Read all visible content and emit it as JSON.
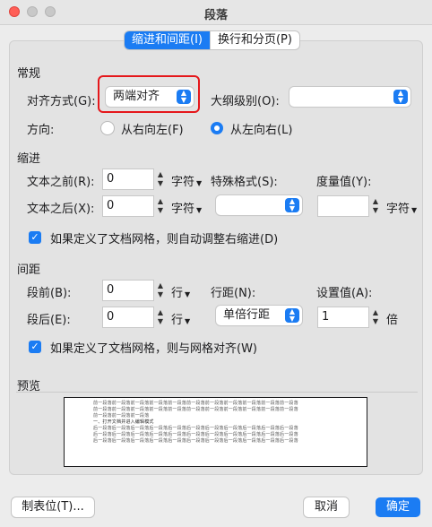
{
  "window": {
    "title": "段落"
  },
  "tabs": [
    {
      "label": "缩进和间距(I)",
      "active": true
    },
    {
      "label": "换行和分页(P)",
      "active": false
    }
  ],
  "general": {
    "section_label": "常规",
    "alignment_label": "对齐方式(G):",
    "alignment_value": "两端对齐",
    "outline_label": "大纲级别(O):",
    "outline_value": "",
    "direction_label": "方向:",
    "rtl_label": "从右向左(F)",
    "ltr_label": "从左向右(L)",
    "direction_selected": "ltr"
  },
  "indent": {
    "section_label": "缩进",
    "before_label": "文本之前(R):",
    "before_value": "0",
    "before_unit": "字符",
    "after_label": "文本之后(X):",
    "after_value": "0",
    "after_unit": "字符",
    "special_label": "特殊格式(S):",
    "special_value": "",
    "measure_label": "度量值(Y):",
    "measure_value": "",
    "measure_unit": "字符",
    "grid_checkbox_label": "如果定义了文档网格，则自动调整右缩进(D)",
    "grid_checked": true
  },
  "spacing": {
    "section_label": "间距",
    "before_label": "段前(B):",
    "before_value": "0",
    "before_unit": "行",
    "after_label": "段后(E):",
    "after_value": "0",
    "after_unit": "行",
    "line_spacing_label": "行距(N):",
    "line_spacing_value": "单倍行距",
    "set_value_label": "设置值(A):",
    "set_value": "1",
    "set_value_unit": "倍",
    "grid_checkbox_label": "如果定义了文档网格，则与网格对齐(W)",
    "grid_checked": true
  },
  "preview": {
    "section_label": "预览",
    "lines": [
      "前一段落前一段落前一段落前一段落前一段落前一段落前一段落前一段落前一段落前一段落前一段落",
      "前一段落前一段落前一段落前一段落前一段落前一段落前一段落前一段落前一段落前一段落前一段落",
      "前一段落前一段落前一段落",
      "一、打开文档并进入编辑模式",
      "后一段落后一段落后一段落后一段落后一段落后一段落后一段落后一段落后一段落后一段落后一段落",
      "后一段落后一段落后一段落后一段落后一段落后一段落后一段落后一段落后一段落后一段落后一段落",
      "后一段落后一段落后一段落后一段落后一段落后一段落后一段落后一段落后一段落后一段落后一段落"
    ]
  },
  "footer": {
    "tabs_button": "制表位(T)...",
    "cancel_button": "取消",
    "ok_button": "确定"
  },
  "colors": {
    "accent": "#1b7cf3",
    "highlight": "#e5171b"
  }
}
